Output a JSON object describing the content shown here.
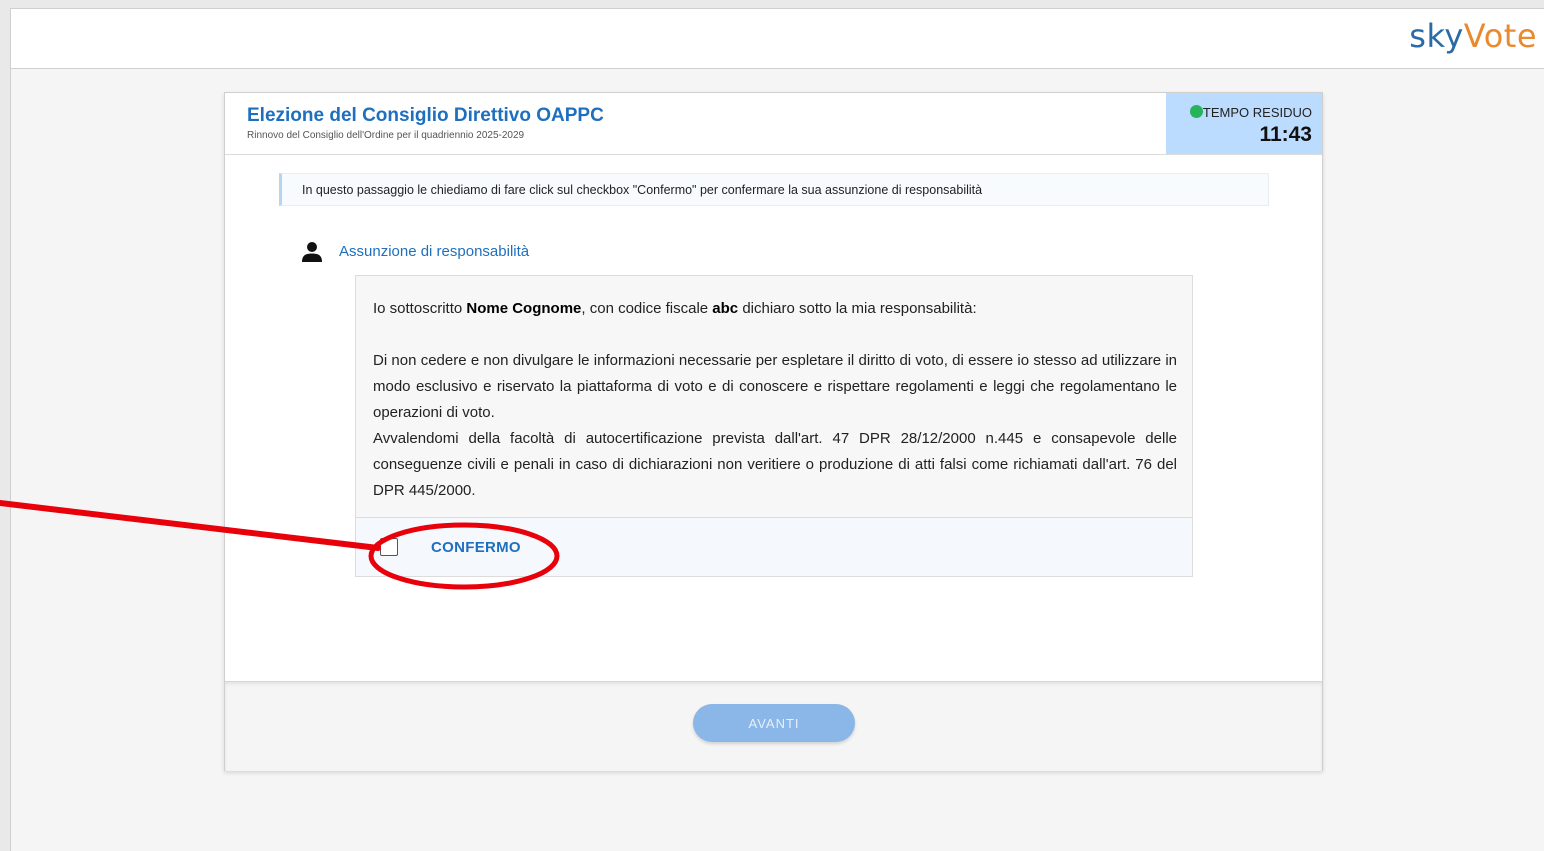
{
  "brand": {
    "sky": "sky",
    "vote": "Vote"
  },
  "header": {
    "title": "Elezione del Consiglio Direttivo OAPPC",
    "subtitle": "Rinnovo del Consiglio dell'Ordine per il quadriennio 2025-2029"
  },
  "timer": {
    "label": "TEMPO RESIDUO",
    "value": "11:43",
    "status_color": "#27b35a"
  },
  "info": {
    "text": "In questo passaggio le chiediamo di fare click sul checkbox \"Confermo\" per confermare la sua assunzione di responsabilità"
  },
  "section": {
    "icon": "user-icon",
    "label": "Assunzione di responsabilità"
  },
  "declaration": {
    "intro_prefix": "Io sottoscritto ",
    "name": "Nome Cognome",
    "intro_middle": ", con codice fiscale ",
    "fiscal_code": "abc",
    "intro_suffix": " dichiaro sotto la mia responsabilità:",
    "paragraph_1": "Di non cedere e non divulgare le informazioni necessarie per espletare il diritto di voto, di essere io stesso ad utilizzare in modo esclusivo e riservato la piattaforma di voto e di conoscere e rispettare regolamenti e leggi che regolamentano le operazioni di voto.",
    "paragraph_2": "Avvalendomi della facoltà di autocertificazione prevista dall'art. 47 DPR 28/12/2000 n.445 e consapevole delle conseguenze civili e penali in caso di dichiarazioni non veritiere o produzione di atti falsi come richiamati dall'art. 76 del DPR 445/2000."
  },
  "confirm": {
    "label": "CONFERMO",
    "checked": false
  },
  "footer": {
    "next_label": "AVANTI",
    "next_enabled": false
  },
  "colors": {
    "accent": "#1f6fbf",
    "timer_bg": "#bcdcff",
    "button_disabled": "#8ab6e8",
    "annotation": "#e8000b"
  }
}
